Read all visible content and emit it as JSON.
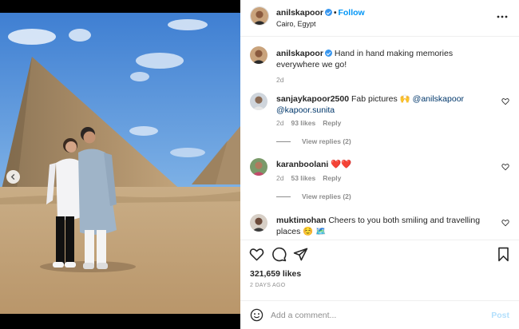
{
  "post": {
    "username": "anilskapoor",
    "follow_label": "Follow",
    "dot": "•",
    "location": "Cairo, Egypt",
    "caption": "Hand in hand making memories everywhere we go!",
    "caption_age": "2d"
  },
  "comments": [
    {
      "username": "sanjaykapoor2500",
      "text_before": "Fab pictures 🙌 ",
      "mention1": "@anilskapoor",
      "mention2": "@kapoor.sunita",
      "age": "2d",
      "likes": "93 likes",
      "reply_label": "Reply",
      "view_replies": "View replies (2)"
    },
    {
      "username": "karanboolani",
      "text": "❤️❤️",
      "age": "2d",
      "likes": "53 likes",
      "reply_label": "Reply",
      "view_replies": "View replies (2)"
    },
    {
      "username": "muktimohan",
      "text": "Cheers to you both smiling and travelling places ☺️ 🗺️"
    }
  ],
  "actions": {
    "like_icon": "heart-icon",
    "comment_icon": "comment-icon",
    "share_icon": "share-icon",
    "save_icon": "bookmark-icon"
  },
  "likes_count": "321,659 likes",
  "timestamp": "2 DAYS AGO",
  "comment_box": {
    "placeholder": "Add a comment...",
    "post_label": "Post"
  },
  "colors": {
    "accent": "#0095f6",
    "verified": "#3897f0",
    "muted": "#8e8e8e",
    "text": "#262626"
  }
}
